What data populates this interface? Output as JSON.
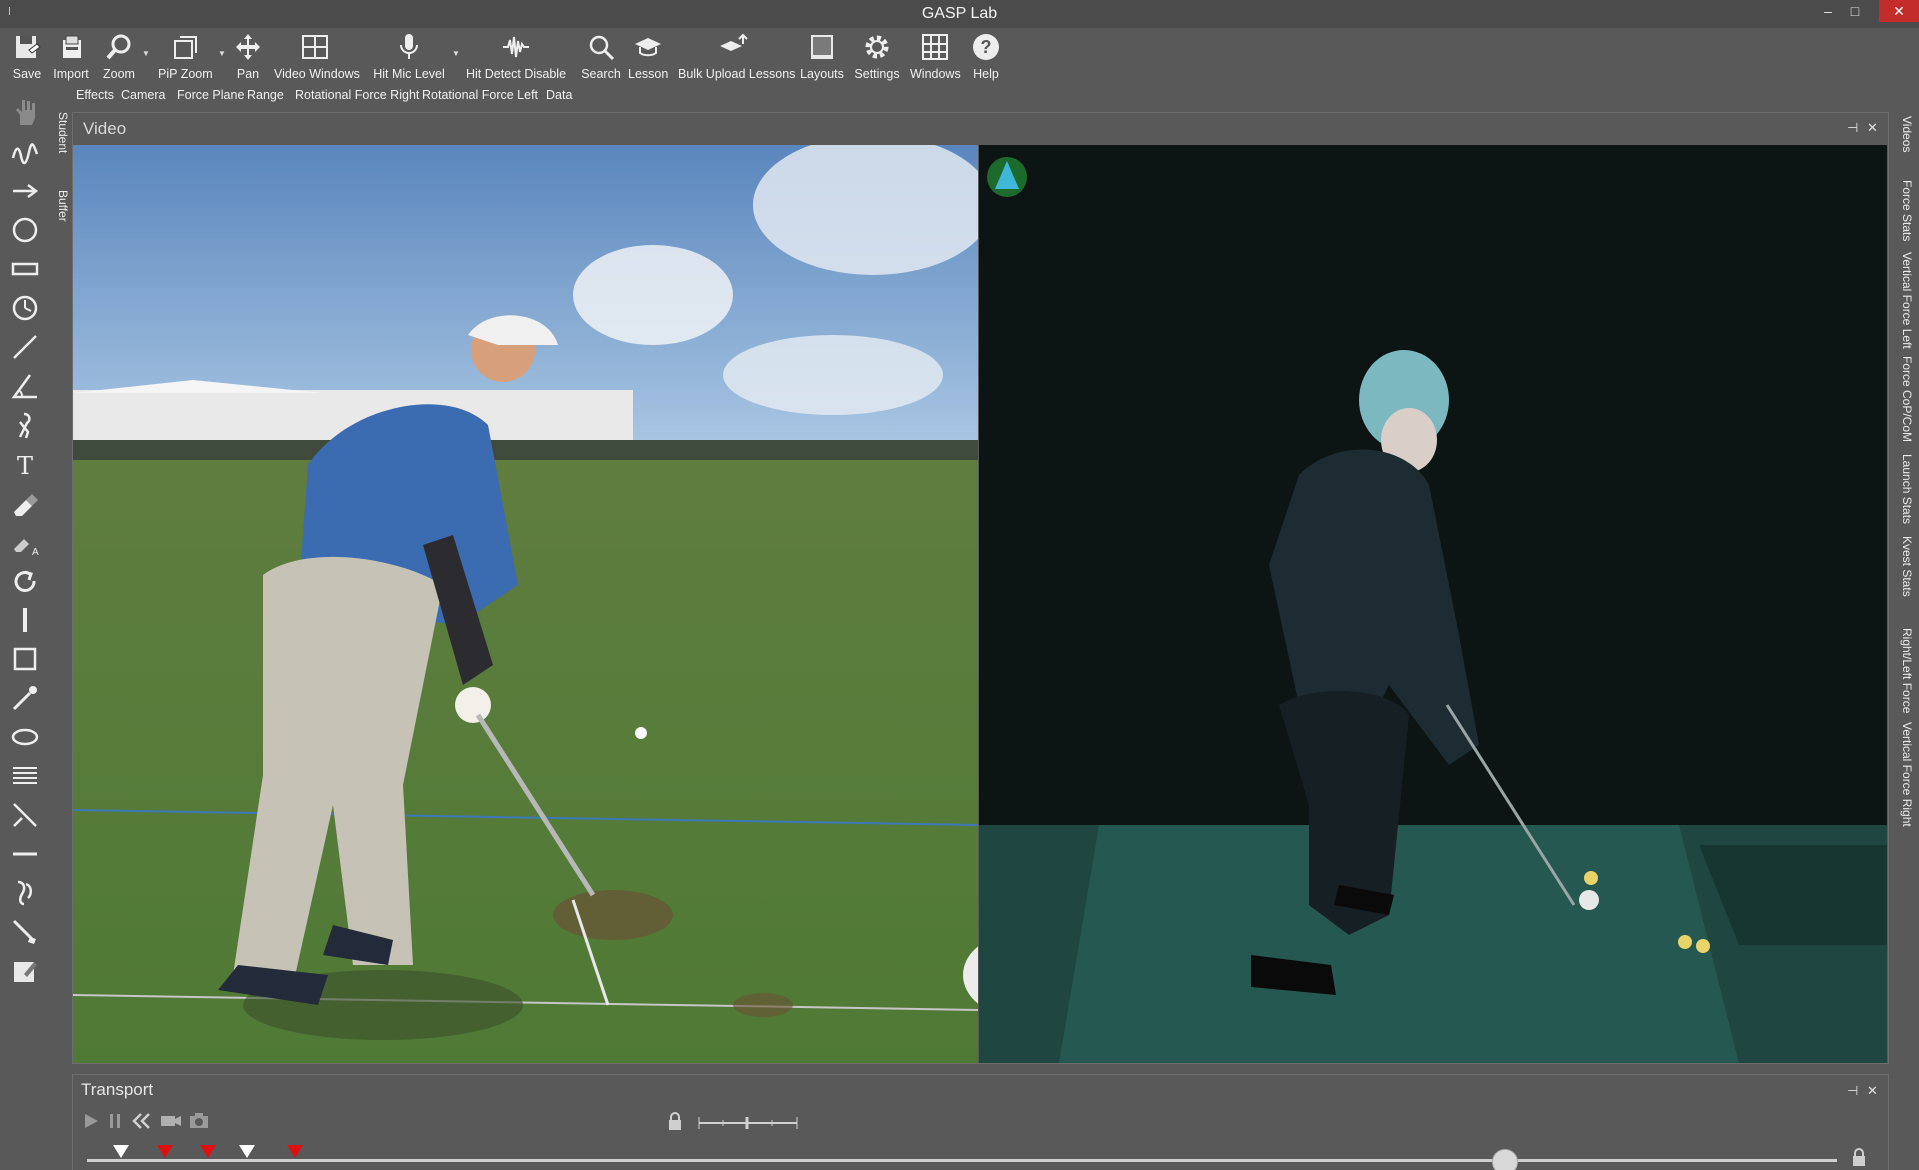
{
  "window": {
    "title": "GASP Lab",
    "minimize": "–",
    "maximize": "□",
    "close": "✕"
  },
  "ribbon": {
    "save": "Save",
    "import": "Import",
    "zoom": "Zoom",
    "pip_zoom": "PiP Zoom",
    "pan": "Pan",
    "video_windows": "Video Windows",
    "hit_mic_level": "Hit Mic Level",
    "hit_detect_disable": "Hit Detect Disable",
    "search": "Search",
    "lesson": "Lesson",
    "bulk_upload": "Bulk Upload Lessons",
    "layouts": "Layouts",
    "settings": "Settings",
    "windows": "Windows",
    "help": "Help",
    "row2": {
      "effects": "Effects",
      "camera": "Camera",
      "force_plane": "Force Plane",
      "range": "Range",
      "rot_force_right": "Rotational Force Right",
      "rot_force_left": "Rotational Force Left",
      "data": "Data"
    }
  },
  "left_strip": {
    "student": "Student",
    "buffer": "Buffer"
  },
  "video_panel": {
    "title": "Video",
    "pin": "⊣",
    "close": "✕"
  },
  "right_strip": {
    "videos": "Videos",
    "force_stats": "Force Stats",
    "vertical_force_left": "Vertical Force Left",
    "force_cop_com": "Force CoP/CoM",
    "launch_stats": "Launch Stats",
    "kvest_stats": "Kvest Stats",
    "right_left_force": "Right/Left Force",
    "vertical_force_right": "Vertical Force Right"
  },
  "transport": {
    "title": "Transport",
    "pin": "⊣",
    "close": "✕"
  },
  "timeline": {
    "markers": [
      "white",
      "red",
      "red",
      "white",
      "red"
    ],
    "playhead_fraction": 0.81
  },
  "colors": {
    "background": "#595959",
    "marker_red": "#e01010",
    "close_red": "#c42b2b"
  }
}
